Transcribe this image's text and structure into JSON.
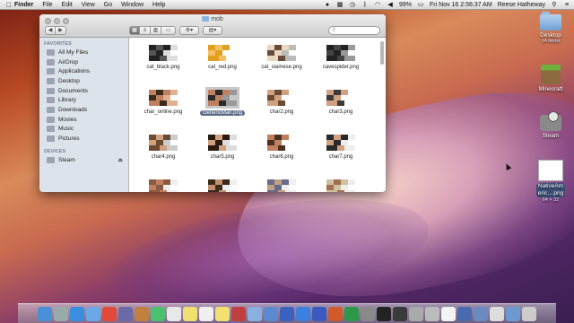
{
  "menubar": {
    "apple": "",
    "items": [
      "Finder",
      "File",
      "Edit",
      "View",
      "Go",
      "Window",
      "Help"
    ],
    "battery": "99%",
    "clock": "Fri Nov 16  2:56:37 AM",
    "user": "Reese Hatheway"
  },
  "finder": {
    "title": "mob",
    "sidebar": {
      "favorites_heading": "FAVORITES",
      "favorites": [
        "All My Files",
        "AirDrop",
        "Applications",
        "Desktop",
        "Documents",
        "Library",
        "Downloads",
        "Movies",
        "Music",
        "Pictures"
      ],
      "devices_heading": "DEVICES",
      "devices": [
        "Steam"
      ]
    },
    "files": [
      {
        "name": "cat_black.png"
      },
      {
        "name": "cat_red.png"
      },
      {
        "name": "cat_siamese.png"
      },
      {
        "name": "cavespider.png"
      },
      {
        "name": "char_online.png"
      },
      {
        "name": "GenericMan.png",
        "selected": true
      },
      {
        "name": "char2.png"
      },
      {
        "name": "char3.png"
      },
      {
        "name": "char4.png"
      },
      {
        "name": "char5.png"
      },
      {
        "name": "char6.png"
      },
      {
        "name": "char7.png"
      },
      {
        "name": ""
      },
      {
        "name": ""
      },
      {
        "name": ""
      },
      {
        "name": ""
      }
    ]
  },
  "desktop": {
    "desktop_folder": {
      "label": "Desktop",
      "sublabel": "14 items"
    },
    "minecraft": {
      "label": "Minecraft"
    },
    "steam": {
      "label": "Steam"
    },
    "native": {
      "label_line1": "NativeAm",
      "label_line2": "eric....png",
      "sublabel": "64 × 32"
    }
  },
  "dock": {
    "apps": [
      "finder-icon",
      "launchpad-icon",
      "safari-icon",
      "mail-icon",
      "chrome-icon",
      "itunes-icon",
      "preview-icon",
      "photo-icon",
      "calendar-icon",
      "notes-icon",
      "reminders-icon",
      "stickies-icon",
      "photobooth-icon",
      "mail2-icon",
      "iphoto-icon",
      "itunes2-icon",
      "appstore-icon",
      "word-icon",
      "powerpoint-icon",
      "excel-icon",
      "sysprefs-icon",
      "terminal-icon",
      "activity-icon",
      "utility-icon",
      "disk-icon",
      "textedit-icon",
      "misc-icon",
      "misc2-icon",
      "misc3-icon",
      "downloads-icon",
      "trash-icon"
    ]
  }
}
